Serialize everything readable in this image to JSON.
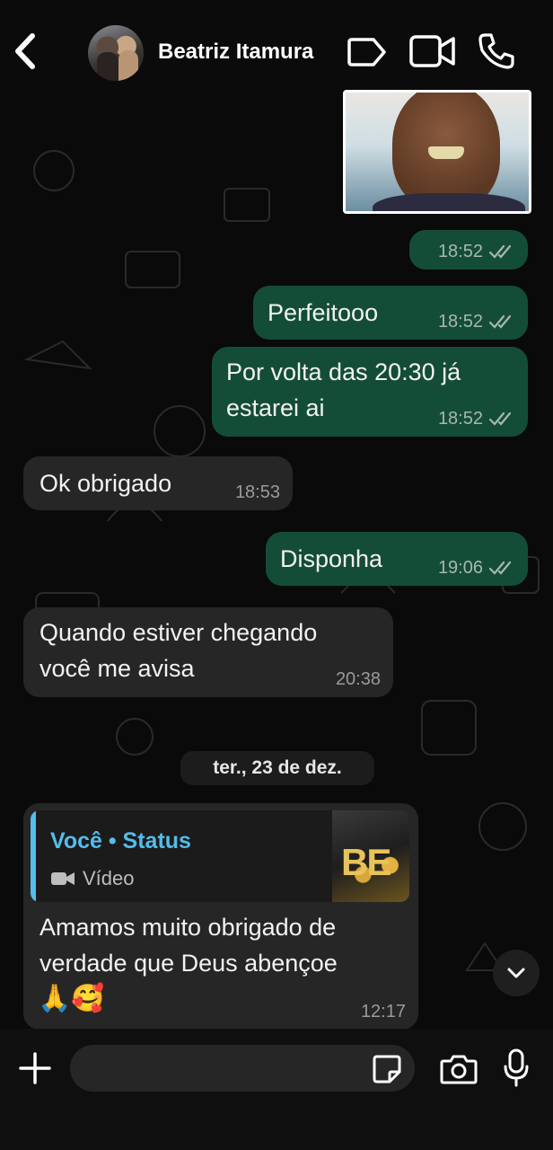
{
  "header": {
    "contact_name": "Beatriz Itamura"
  },
  "messages": [
    {
      "type": "image",
      "direction": "out",
      "time": "18:52",
      "status": "read"
    },
    {
      "direction": "out",
      "text": "Perfeitooo",
      "time": "18:52",
      "status": "read"
    },
    {
      "direction": "out",
      "text_line1": "Por volta das 20:30 já",
      "text_line2": "estarei ai",
      "time": "18:52",
      "status": "read"
    },
    {
      "direction": "in",
      "text": "Ok obrigado",
      "time": "18:53"
    },
    {
      "direction": "out",
      "text": "Disponha",
      "time": "19:06",
      "status": "read"
    },
    {
      "direction": "in",
      "text_line1": "Quando estiver chegando",
      "text_line2": "você me avisa",
      "time": "20:38"
    }
  ],
  "date_separator": "ter., 23 de dez.",
  "reply_message": {
    "quote_title": "Você • Status",
    "quote_sub": "Vídeo",
    "text_line1": "Amamos muito obrigado de",
    "text_line2": "verdade que Deus abençoe",
    "emoji": "🙏🥰",
    "time": "12:17"
  },
  "composer": {
    "placeholder": ""
  },
  "colors": {
    "outgoing_bubble": "#144d37",
    "incoming_bubble": "#262626",
    "status_accent": "#53bdeb"
  },
  "icons": [
    "back-chevron-icon",
    "sticker-icon",
    "video-call-icon",
    "voice-call-icon",
    "plus-icon",
    "camera-icon",
    "microphone-icon",
    "chevron-down-icon",
    "read-receipt-icon",
    "video-icon"
  ]
}
